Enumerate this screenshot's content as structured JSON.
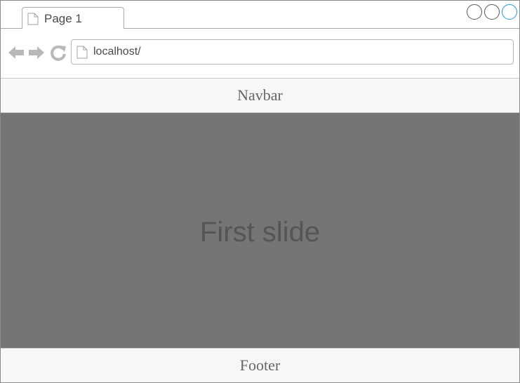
{
  "tab": {
    "title": "Page 1",
    "icon": "document-icon"
  },
  "window_controls": [
    {
      "name": "minimize",
      "color": "#555555"
    },
    {
      "name": "maximize",
      "color": "#555555"
    },
    {
      "name": "close",
      "color": "#1a9ad6"
    }
  ],
  "address_bar": {
    "url": "localhost/",
    "icon": "document-icon"
  },
  "navigation": {
    "back_icon": "arrow-left-icon",
    "forward_icon": "arrow-right-icon",
    "reload_icon": "reload-icon"
  },
  "navbar": {
    "label": "Navbar"
  },
  "carousel": {
    "slide_label": "First slide",
    "background": "#757575"
  },
  "footer": {
    "label": "Footer"
  }
}
